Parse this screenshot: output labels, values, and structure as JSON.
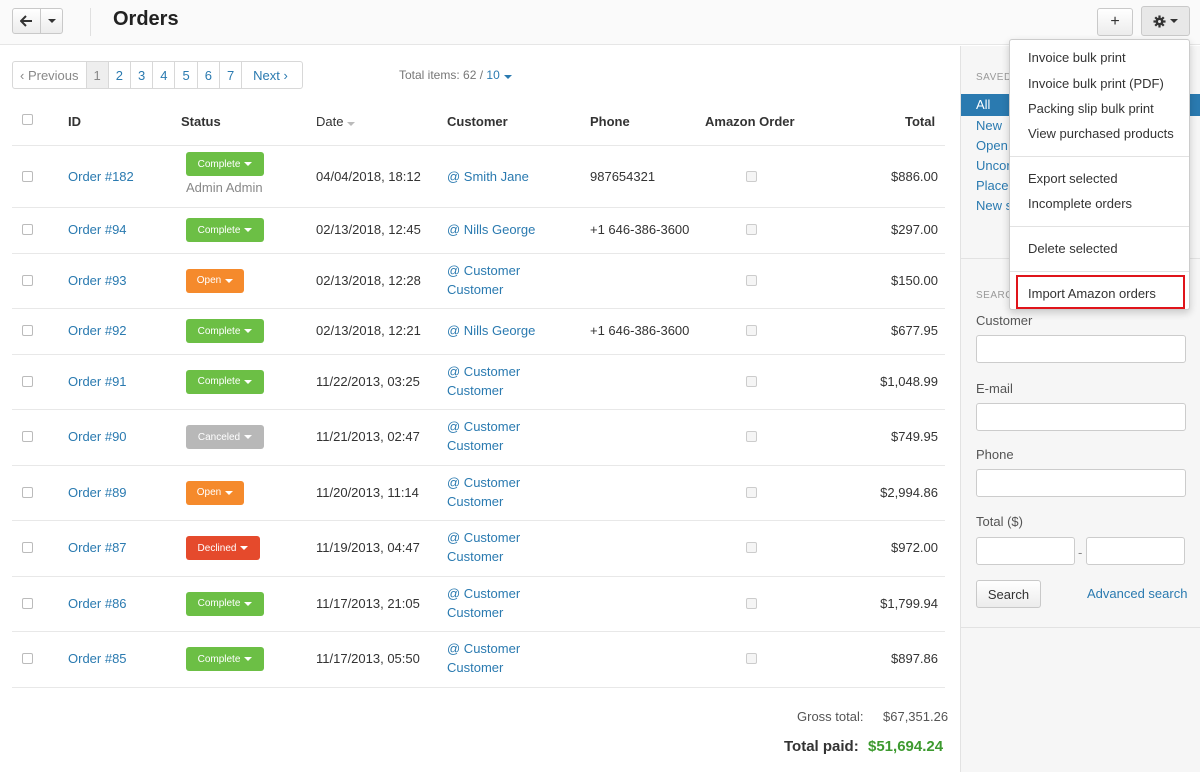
{
  "header": {
    "title": "Orders",
    "add_label": "+"
  },
  "pager": {
    "previous": "‹ Previous",
    "pages": [
      "1",
      "2",
      "3",
      "4",
      "5",
      "6",
      "7"
    ],
    "next": "Next ›",
    "total_label": "Total items: 62 /",
    "per_page": "10"
  },
  "columns": {
    "id": "ID",
    "status": "Status",
    "date": "Date",
    "customer": "Customer",
    "phone": "Phone",
    "amazon": "Amazon Order",
    "total": "Total"
  },
  "rows": [
    {
      "id": "Order #182",
      "status": "Complete",
      "sub": "Admin Admin",
      "date": "04/04/2018, 18:12",
      "c1": "@ Smith Jane",
      "c2": "",
      "phone": "987654321",
      "total": "$886.00"
    },
    {
      "id": "Order #94",
      "status": "Complete",
      "sub": "",
      "date": "02/13/2018, 12:45",
      "c1": "@ Nills George",
      "c2": "",
      "phone": "+1 646-386-3600",
      "total": "$297.00"
    },
    {
      "id": "Order #93",
      "status": "Open",
      "sub": "",
      "date": "02/13/2018, 12:28",
      "c1": "@ Customer",
      "c2": "Customer",
      "phone": "",
      "total": "$150.00"
    },
    {
      "id": "Order #92",
      "status": "Complete",
      "sub": "",
      "date": "02/13/2018, 12:21",
      "c1": "@ Nills George",
      "c2": "",
      "phone": "+1 646-386-3600",
      "total": "$677.95"
    },
    {
      "id": "Order #91",
      "status": "Complete",
      "sub": "",
      "date": "11/22/2013, 03:25",
      "c1": "@ Customer",
      "c2": "Customer",
      "phone": "",
      "total": "$1,048.99"
    },
    {
      "id": "Order #90",
      "status": "Canceled",
      "sub": "",
      "date": "11/21/2013, 02:47",
      "c1": "@ Customer",
      "c2": "Customer",
      "phone": "",
      "total": "$749.95"
    },
    {
      "id": "Order #89",
      "status": "Open",
      "sub": "",
      "date": "11/20/2013, 11:14",
      "c1": "@ Customer",
      "c2": "Customer",
      "phone": "",
      "total": "$2,994.86"
    },
    {
      "id": "Order #87",
      "status": "Declined",
      "sub": "",
      "date": "11/19/2013, 04:47",
      "c1": "@ Customer",
      "c2": "Customer",
      "phone": "",
      "total": "$972.00"
    },
    {
      "id": "Order #86",
      "status": "Complete",
      "sub": "",
      "date": "11/17/2013, 21:05",
      "c1": "@ Customer",
      "c2": "Customer",
      "phone": "",
      "total": "$1,799.94"
    },
    {
      "id": "Order #85",
      "status": "Complete",
      "sub": "",
      "date": "11/17/2013, 05:50",
      "c1": "@ Customer",
      "c2": "Customer",
      "phone": "",
      "total": "$897.86"
    }
  ],
  "status_colors": {
    "Complete": "#6cbf45",
    "Open": "#f58a2c",
    "Canceled": "#b8b8b8",
    "Declined": "#e54a2c"
  },
  "totals": {
    "gross_label": "Gross total:",
    "gross_value": "$67,351.26",
    "paid_label": "Total paid:",
    "paid_value": "$51,694.24"
  },
  "sidebar": {
    "saved_title": "SAVED",
    "views": [
      "All",
      "New",
      "Open",
      "Uncor",
      "Placed",
      "New s"
    ],
    "search_title": "SEARC",
    "customer_label": "Customer",
    "email_label": "E-mail",
    "phone_label": "Phone",
    "total_label": "Total ($)",
    "range_sep": "-",
    "search_button": "Search",
    "advanced_link": "Advanced search"
  },
  "menu": {
    "items_group1": [
      "Invoice bulk print",
      "Invoice bulk print (PDF)",
      "Packing slip bulk print",
      "View purchased products"
    ],
    "items_group2": [
      "Export selected",
      "Incomplete orders"
    ],
    "items_group3": [
      "Delete selected"
    ],
    "items_group4": [
      "Import Amazon orders"
    ]
  },
  "icons": {
    "back": "arrow-left-icon",
    "settings": "gear-icon",
    "sort": "sort-desc-icon"
  }
}
